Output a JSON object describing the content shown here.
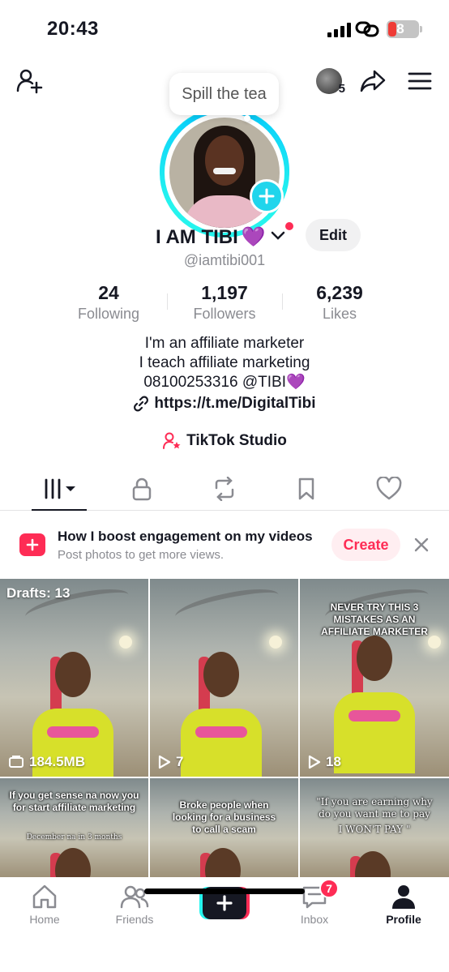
{
  "status_bar": {
    "time": "20:43",
    "battery": "8"
  },
  "header": {
    "visitor_count": "5",
    "tooltip": "Spill the tea"
  },
  "profile": {
    "name": "I AM TIBI",
    "name_emoji": "💜",
    "username": "@iamtibi001",
    "edit_label": "Edit",
    "stats": [
      {
        "value": "24",
        "label": "Following"
      },
      {
        "value": "1,197",
        "label": "Followers"
      },
      {
        "value": "6,239",
        "label": "Likes"
      }
    ],
    "bio": {
      "line1": "I'm an affiliate marketer",
      "line2": "I teach affiliate marketing",
      "line3": "08100253316 @TIBI💜",
      "link": "https://t.me/DigitalTibi"
    },
    "studio_label": "TikTok Studio"
  },
  "tabs": [
    "videos-grid-icon",
    "lock-icon",
    "repost-icon",
    "bookmark-icon",
    "heart-icon"
  ],
  "banner": {
    "title": "How I boost engagement on my videos",
    "subtitle": "Post photos to get more views.",
    "create_label": "Create"
  },
  "grid": {
    "tiles": [
      {
        "overlay": "Drafts: 13",
        "meta": "184.5MB"
      },
      {
        "caption": "",
        "meta": "7"
      },
      {
        "caption": "NEVER TRY THIS 3 MISTAKES AS AN AFFILIATE MARKETER",
        "meta": "18"
      },
      {
        "caption": "If you get sense na now you for start affiliate marketing",
        "sub": "December na in 3 months"
      },
      {
        "caption": "Broke people when looking for a business to call a scam"
      },
      {
        "caption": "\"If you are earning why do you want me to pay",
        "sub": "I WON'T PAY \""
      }
    ]
  },
  "nav": {
    "home": "Home",
    "friends": "Friends",
    "inbox": "Inbox",
    "inbox_badge": "7",
    "profile": "Profile"
  },
  "colors": {
    "accent": "#fe2c55",
    "ring": "#25f4ee",
    "text": "#161823",
    "muted": "#8a8b91"
  }
}
